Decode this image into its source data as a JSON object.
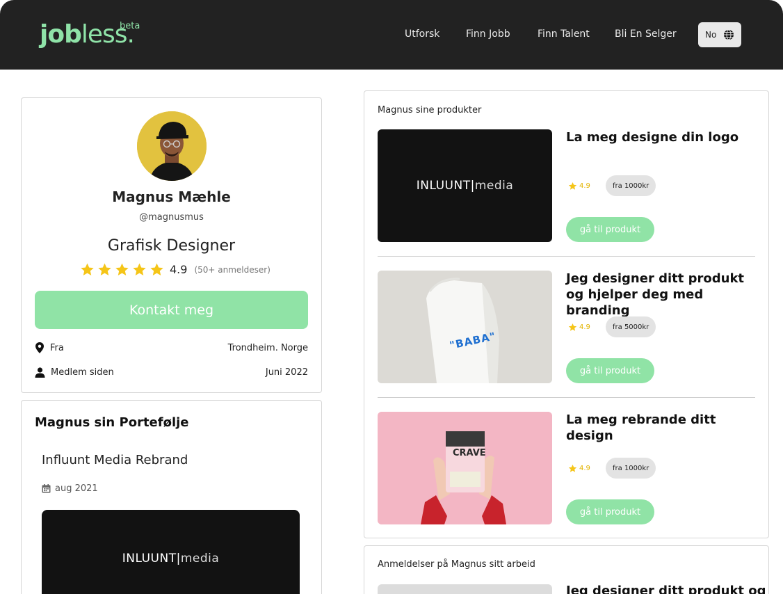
{
  "header": {
    "logo_bold": "job",
    "logo_light": "less.",
    "logo_badge": "beta",
    "nav": [
      "Utforsk",
      "Finn Jobb",
      "Finn Talent",
      "Bli En Selger"
    ],
    "language": "No",
    "language_icon": "globe-icon"
  },
  "profile": {
    "name": "Magnus Mæhle",
    "handle": "@magnusmus",
    "title": "Grafisk Designer",
    "rating": "4.9",
    "stars": 5,
    "review_count": "(50+ anmeldeser)",
    "contact_label": "Kontakt meg",
    "from_label": "Fra",
    "from_value": "Trondheim. Norge",
    "member_label": "Medlem siden",
    "member_value": "Juni 2022"
  },
  "portfolio": {
    "heading": "Magnus sin Portefølje",
    "item_title": "Influunt Media Rebrand",
    "item_date": "aug 2021",
    "image_text_bold": "INLUUNT",
    "image_text_light": "media"
  },
  "products": {
    "heading": "Magnus sine produkter",
    "items": [
      {
        "title": "La meg designe din logo",
        "rating": "4.9",
        "price": "fra 1000kr",
        "button": "gå til produkt",
        "image_text_bold": "INLUUNT",
        "image_text_light": "media"
      },
      {
        "title": "Jeg designer ditt produkt og hjelper deg med branding",
        "rating": "4.9",
        "price": "fra 5000kr",
        "button": "gå til produkt",
        "image_text": "\"BABA\""
      },
      {
        "title": "La meg rebrande ditt design",
        "rating": "4.9",
        "price": "fra 1000kr",
        "button": "gå til produkt",
        "image_text": "CRAVE"
      }
    ]
  },
  "reviews": {
    "heading": "Anmeldelser på Magnus sitt arbeid",
    "item_title": "Jeg designer ditt produkt og"
  },
  "colors": {
    "accent": "#90e3a6",
    "header_bg": "#222222",
    "star": "#f5c518"
  }
}
